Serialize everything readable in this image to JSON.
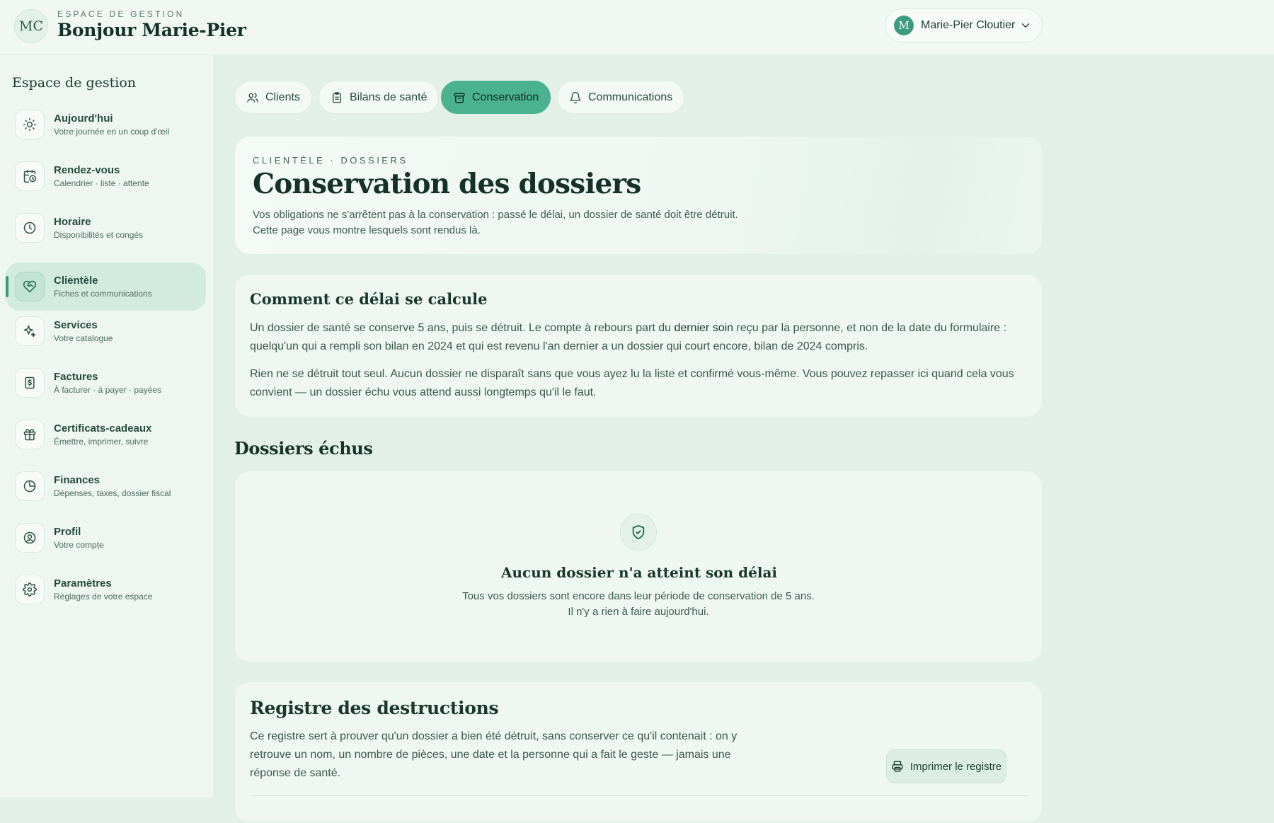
{
  "header": {
    "initials": "MC",
    "eyebrow": "ESPACE DE GESTION",
    "greeting": "Bonjour Marie-Pier",
    "user": {
      "initial": "M",
      "name": "Marie-Pier Cloutier"
    }
  },
  "sidebar": {
    "title": "Espace de gestion",
    "items": [
      {
        "label": "Aujourd'hui",
        "sub": "Votre journée en un coup d'œil",
        "icon": "sun-icon"
      },
      {
        "label": "Rendez-vous",
        "sub": "Calendrier · liste · attente",
        "icon": "calendar-clock-icon"
      },
      {
        "label": "Horaire",
        "sub": "Disponibilités et congés",
        "icon": "clock-icon"
      },
      {
        "label": "Clientèle",
        "sub": "Fiches et communications",
        "icon": "heart-handshake-icon",
        "active": true
      },
      {
        "label": "Services",
        "sub": "Votre catalogue",
        "icon": "sparkles-icon"
      },
      {
        "label": "Factures",
        "sub": "À facturer · à payer · payées",
        "icon": "receipt-icon"
      },
      {
        "label": "Certificats-cadeaux",
        "sub": "Émettre, imprimer, suivre",
        "icon": "gift-icon"
      },
      {
        "label": "Finances",
        "sub": "Dépenses, taxes, dossier fiscal",
        "icon": "pie-chart-icon"
      },
      {
        "label": "Profil",
        "sub": "Votre compte",
        "icon": "user-circle-icon"
      },
      {
        "label": "Paramètres",
        "sub": "Réglages de votre espace",
        "icon": "gear-icon"
      }
    ]
  },
  "tabs": [
    {
      "label": "Clients",
      "icon": "users-icon"
    },
    {
      "label": "Bilans de santé",
      "icon": "clipboard-icon"
    },
    {
      "label": "Conservation",
      "icon": "archive-icon",
      "active": true
    },
    {
      "label": "Communications",
      "icon": "bell-icon"
    }
  ],
  "hero": {
    "eyebrow": "CLIENTÈLE · DOSSIERS",
    "title": "Conservation des dossiers",
    "line1": "Vos obligations ne s'arrêtent pas à la conservation : passé le délai, un dossier de santé doit être détruit.",
    "line2": "Cette page vous montre lesquels sont rendus là."
  },
  "calc": {
    "title": "Comment ce délai se calcule",
    "p1_before": "Un dossier de santé se conserve 5 ans, puis se détruit. Le compte à rebours part du ",
    "p1_strong": "dernier soin",
    "p1_after": " reçu par la personne, et non de la date du formulaire : quelqu'un qui a rempli son bilan en 2024 et qui est revenu l'an dernier a un dossier qui court encore, bilan de 2024 compris.",
    "p2": "Rien ne se détruit tout seul. Aucun dossier ne disparaît sans que vous ayez lu la liste et confirmé vous-même. Vous pouvez repasser ici quand cela vous convient — un dossier échu vous attend aussi longtemps qu'il le faut."
  },
  "expired": {
    "heading": "Dossiers échus",
    "empty_title": "Aucun dossier n'a atteint son délai",
    "empty_desc": "Tous vos dossiers sont encore dans leur période de conservation de 5 ans. Il n'y a rien à faire aujourd'hui."
  },
  "registry": {
    "title": "Registre des destructions",
    "desc": "Ce registre sert à prouver qu'un dossier a bien été détruit, sans conserver ce qu'il contenait : on y retrouve un nom, un nombre de pièces, une date et la personne qui a fait le geste — jamais une réponse de santé.",
    "print_label": "Imprimer le registre"
  },
  "colors": {
    "accent": "#4bb28f",
    "accent_dark": "#3b9a7a",
    "page_bg": "#e3f0e8"
  }
}
